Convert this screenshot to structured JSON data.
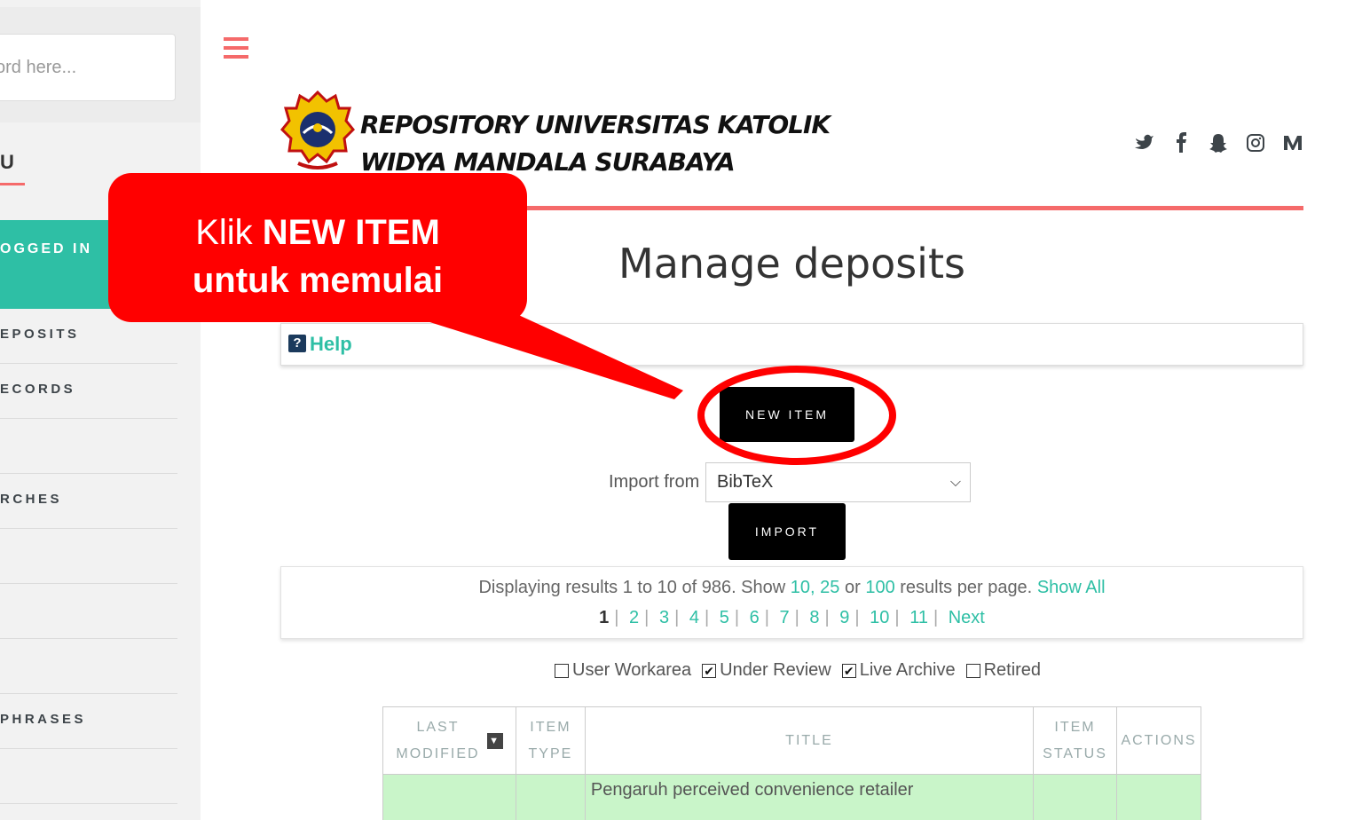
{
  "sidebar": {
    "search_placeholder": "ord here...",
    "menu_heading": "U",
    "logged_in": "OGGED IN",
    "items": [
      {
        "label": "EPOSITS"
      },
      {
        "label": "ECORDS"
      },
      {
        "label": ""
      },
      {
        "label": "RCHES"
      },
      {
        "label": ""
      },
      {
        "label": ""
      },
      {
        "label": ""
      },
      {
        "label": "PHRASES"
      },
      {
        "label": ""
      }
    ]
  },
  "header": {
    "brand_line1": "REPOSITORY UNIVERSITAS KATOLIK",
    "brand_line2": "WIDYA MANDALA SURABAYA",
    "social_icons": [
      "twitter-icon",
      "facebook-icon",
      "snapchat-icon",
      "instagram-icon",
      "medium-icon"
    ],
    "accent_color": "#f56a6a"
  },
  "main": {
    "page_title": "Manage deposits",
    "help_label": "Help",
    "new_item_label": "NEW ITEM",
    "import_label": "Import from",
    "import_selected": "BibTeX",
    "import_button": "IMPORT",
    "results": {
      "prefix": "Displaying results 1 to 10 of 986. Show",
      "opt_10": "10,",
      "opt_25": "25",
      "or": "or",
      "opt_100": "100",
      "suffix": "results per page.",
      "show_all": "Show All",
      "pages": [
        "1",
        "2",
        "3",
        "4",
        "5",
        "6",
        "7",
        "8",
        "9",
        "10",
        "11"
      ],
      "next": "Next"
    },
    "filters": [
      {
        "label": "User Workarea",
        "checked": false
      },
      {
        "label": "Under Review",
        "checked": true
      },
      {
        "label": "Live Archive",
        "checked": true
      },
      {
        "label": "Retired",
        "checked": false
      }
    ],
    "table": {
      "col_last1": "LAST",
      "col_last2": "MODIFIED",
      "col_type1": "ITEM",
      "col_type2": "TYPE",
      "col_title": "TITLE",
      "col_status1": "ITEM",
      "col_status2": "STATUS",
      "col_actions": "ACTIONS",
      "row1_title": "Pengaruh perceived convenience retailer"
    }
  },
  "annotation": {
    "line1_plain": "Klik ",
    "line1_bold": "NEW ITEM",
    "line2": "untuk memulai",
    "color": "#ff0000"
  }
}
